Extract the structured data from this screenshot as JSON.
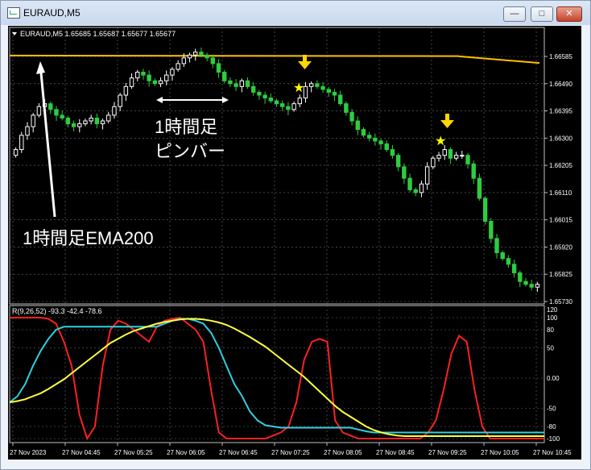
{
  "window": {
    "title": "EURAUD,M5",
    "minimize_glyph": "—",
    "maximize_glyph": "□",
    "close_glyph": "✕"
  },
  "chart": {
    "header": "EURAUD,M5  1.65685 1.65687 1.65677 1.65677",
    "annotation_ema": "1時間足EMA200",
    "annotation_pinbar_line1": "1時間足",
    "annotation_pinbar_line2": "ピンバー",
    "price_labels": [
      "1.66585",
      "1.66490",
      "1.66395",
      "1.66300",
      "1.66205",
      "1.66110",
      "1.66015",
      "1.65920",
      "1.65825",
      "1.65730"
    ],
    "star_color": "#ffff00",
    "arrow_color": "#ffd700",
    "ema_color": "#ffc000",
    "bull_color": "#ffffff",
    "bear_color": "#2ecc40"
  },
  "indicator": {
    "header": "R(9,26,52) -93.3 -42.4 -78.6",
    "scale_labels": [
      "120",
      "100",
      "80",
      "50",
      "0.00",
      "-50",
      "-80",
      "-100"
    ],
    "red_color": "#ff2020",
    "cyan_color": "#30d0e0",
    "yellow_color": "#ffff40"
  },
  "time_axis": [
    "27 Nov 2023",
    "27 Nov 04:45",
    "27 Nov 05:25",
    "27 Nov 06:05",
    "27 Nov 06:45",
    "27 Nov 07:25",
    "27 Nov 08:05",
    "27 Nov 08:45",
    "27 Nov 09:25",
    "27 Nov 10:05",
    "27 Nov 10:45"
  ],
  "chart_data": {
    "type": "candlestick",
    "price_axis": {
      "ticks": [
        1.66585,
        1.6649,
        1.66395,
        1.663,
        1.66205,
        1.6611,
        1.66015,
        1.6592,
        1.65825,
        1.6573
      ]
    },
    "close_series": [
      1.6626,
      1.6631,
      1.6634,
      1.6638,
      1.6641,
      1.6642,
      1.664,
      1.6638,
      1.6637,
      1.6635,
      1.6634,
      1.6635,
      1.6636,
      1.6637,
      1.6635,
      1.6636,
      1.6638,
      1.6641,
      1.6645,
      1.6648,
      1.6651,
      1.6653,
      1.6652,
      1.665,
      1.6649,
      1.665,
      1.6652,
      1.6654,
      1.6656,
      1.6658,
      1.6659,
      1.666,
      1.6659,
      1.6658,
      1.6656,
      1.6653,
      1.665,
      1.6649,
      1.6648,
      1.665,
      1.6648,
      1.6646,
      1.6645,
      1.6644,
      1.6643,
      1.6642,
      1.6641,
      1.664,
      1.6642,
      1.6644,
      1.6648,
      1.6649,
      1.6648,
      1.6647,
      1.6646,
      1.6645,
      1.6642,
      1.6639,
      1.6636,
      1.6633,
      1.6631,
      1.663,
      1.6629,
      1.6628,
      1.6626,
      1.6624,
      1.662,
      1.6616,
      1.6612,
      1.6611,
      1.6614,
      1.662,
      1.6623,
      1.6624,
      1.6626,
      1.6623,
      1.6624,
      1.6624,
      1.6621,
      1.6616,
      1.6609,
      1.6601,
      1.6595,
      1.659,
      1.6588,
      1.6586,
      1.6583,
      1.658,
      1.6579,
      1.6578,
      1.6579
    ],
    "ema200": {
      "start": 1.66588,
      "end": 1.66562
    },
    "oscillator": {
      "header": "R(9,26,52)",
      "range": [
        -120,
        120
      ],
      "red": [
        100,
        100,
        100,
        100,
        100,
        98,
        90,
        60,
        20,
        -60,
        -100,
        -80,
        20,
        80,
        95,
        90,
        80,
        70,
        60,
        85,
        95,
        98,
        100,
        90,
        80,
        60,
        -20,
        -90,
        -100,
        -100,
        -100,
        -100,
        -100,
        -100,
        -95,
        -90,
        -80,
        -40,
        30,
        60,
        65,
        60,
        -70,
        -90,
        -95,
        -100,
        -100,
        -100,
        -100,
        -100,
        -100,
        -100,
        -100,
        -100,
        -90,
        -70,
        -20,
        40,
        70,
        60,
        -20,
        -80,
        -100,
        -100,
        -100,
        -100,
        -100,
        -100,
        -100,
        -100
      ],
      "cyan": [
        -40,
        -30,
        -10,
        20,
        45,
        65,
        80,
        85,
        85,
        85,
        85,
        85,
        85,
        85,
        85,
        85,
        85,
        85,
        85,
        85,
        90,
        95,
        98,
        98,
        95,
        90,
        75,
        50,
        20,
        -10,
        -30,
        -55,
        -70,
        -78,
        -80,
        -82,
        -82,
        -82,
        -82,
        -82,
        -82,
        -82,
        -82,
        -82,
        -82,
        -85,
        -88,
        -90,
        -90,
        -90,
        -90,
        -90,
        -90,
        -90,
        -90,
        -90,
        -90,
        -90,
        -90,
        -90,
        -90,
        -90,
        -90,
        -90,
        -90,
        -90,
        -90,
        -90,
        -90,
        -90
      ],
      "yellow": [
        -40,
        -38,
        -35,
        -30,
        -25,
        -18,
        -10,
        -2,
        8,
        18,
        28,
        38,
        48,
        58,
        65,
        72,
        78,
        82,
        86,
        90,
        93,
        95,
        97,
        98,
        98,
        97,
        95,
        92,
        88,
        82,
        75,
        68,
        60,
        52,
        42,
        32,
        22,
        12,
        2,
        -10,
        -22,
        -34,
        -46,
        -56,
        -64,
        -72,
        -80,
        -86,
        -90,
        -93,
        -95,
        -96,
        -96,
        -96,
        -96,
        -96,
        -96,
        -96,
        -96,
        -96,
        -96,
        -96,
        -96,
        -96,
        -96,
        -96,
        -96,
        -96,
        -96,
        -96
      ]
    }
  }
}
